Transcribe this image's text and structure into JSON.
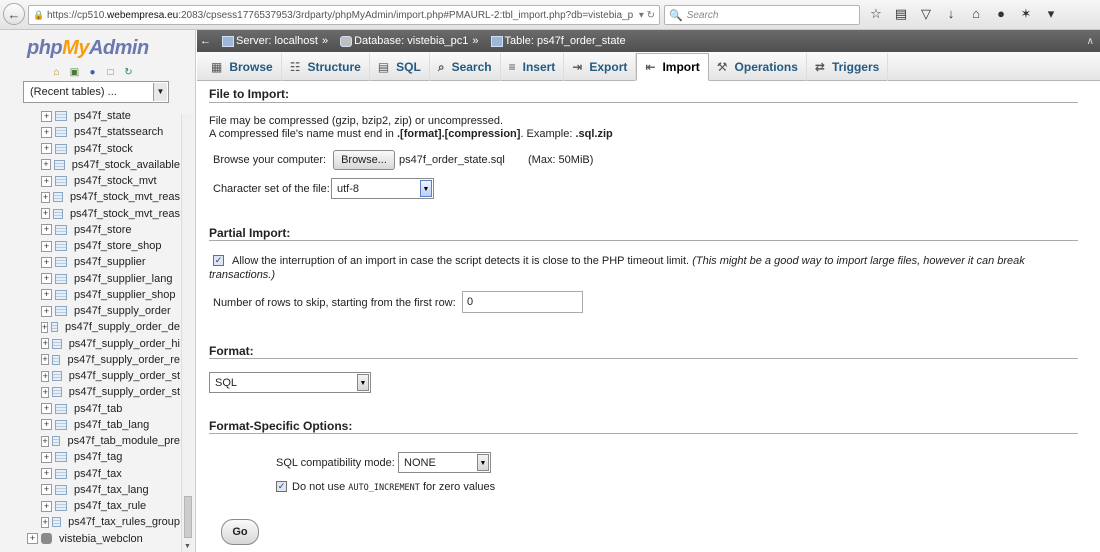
{
  "browser": {
    "url_prefix": "https://cp510.",
    "url_domain": "webempresa.eu",
    "url_rest": ":2083/cpsess1776537953/3rdparty/phpMyAdmin/import.php#PMAURL-2:tbl_import.php?db=vistebia_p",
    "search_placeholder": "Search"
  },
  "sidebar": {
    "logo_php": "php",
    "logo_my": "My",
    "logo_admin": "Admin",
    "recent_tables": "(Recent tables) ...",
    "tables": [
      "ps47f_state",
      "ps47f_statssearch",
      "ps47f_stock",
      "ps47f_stock_available",
      "ps47f_stock_mvt",
      "ps47f_stock_mvt_reas",
      "ps47f_stock_mvt_reas",
      "ps47f_store",
      "ps47f_store_shop",
      "ps47f_supplier",
      "ps47f_supplier_lang",
      "ps47f_supplier_shop",
      "ps47f_supply_order",
      "ps47f_supply_order_de",
      "ps47f_supply_order_hi",
      "ps47f_supply_order_re",
      "ps47f_supply_order_st",
      "ps47f_supply_order_st",
      "ps47f_tab",
      "ps47f_tab_lang",
      "ps47f_tab_module_pre",
      "ps47f_tag",
      "ps47f_tax",
      "ps47f_tax_lang",
      "ps47f_tax_rule",
      "ps47f_tax_rules_group"
    ],
    "database": "vistebia_webclon"
  },
  "breadcrumb": {
    "server": "Server: localhost",
    "database": "Database: vistebia_pc1",
    "table": "Table: ps47f_order_state"
  },
  "tabs": [
    {
      "label": "Browse",
      "icon": "browse-icon"
    },
    {
      "label": "Structure",
      "icon": "structure-icon"
    },
    {
      "label": "SQL",
      "icon": "sql-icon"
    },
    {
      "label": "Search",
      "icon": "search-icon"
    },
    {
      "label": "Insert",
      "icon": "insert-icon"
    },
    {
      "label": "Export",
      "icon": "export-icon"
    },
    {
      "label": "Import",
      "icon": "import-icon",
      "active": true
    },
    {
      "label": "Operations",
      "icon": "operations-icon"
    },
    {
      "label": "Triggers",
      "icon": "triggers-icon"
    }
  ],
  "file_import": {
    "title": "File to Import:",
    "line1": "File may be compressed (gzip, bzip2, zip) or uncompressed.",
    "line2_a": "A compressed file's name must end in ",
    "line2_b": ".[format].[compression]",
    "line2_c": ". Example: ",
    "line2_d": ".sql.zip",
    "browse_label": "Browse your computer:",
    "browse_button": "Browse...",
    "file_name": "ps47f_order_state.sql",
    "max_size": "(Max: 50MiB)",
    "charset_label": "Character set of the file:",
    "charset_value": "utf-8"
  },
  "partial_import": {
    "title": "Partial Import:",
    "allow_interrupt_checked": true,
    "allow_interrupt_text": "Allow the interruption of an import in case the script detects it is close to the PHP timeout limit.",
    "allow_interrupt_note_a": "(This might be a good way to import large files, however it can break",
    "allow_interrupt_note_b": "transactions.)",
    "skip_label": "Number of rows to skip, starting from the first row:",
    "skip_value": "0"
  },
  "format": {
    "title": "Format:",
    "value": "SQL"
  },
  "format_options": {
    "title": "Format-Specific Options:",
    "compat_label": "SQL compatibility mode:",
    "compat_value": "NONE",
    "auto_increment_checked": true,
    "auto_increment_a": "Do not use ",
    "auto_increment_code": "AUTO_INCREMENT",
    "auto_increment_b": " for zero values"
  },
  "go_button": "Go"
}
